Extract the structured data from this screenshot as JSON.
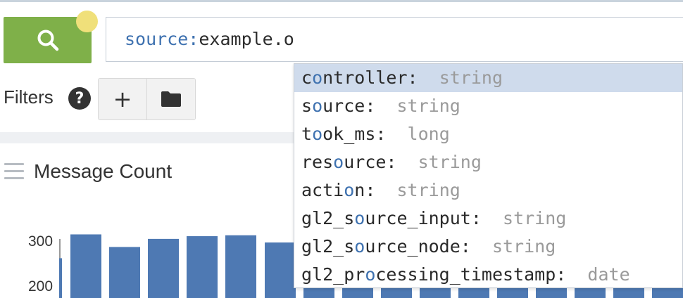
{
  "search": {
    "button_icon": "search-icon",
    "query_key": "source:",
    "query_value": "example.o"
  },
  "filters": {
    "label": "Filters",
    "help_glyph": "?",
    "add_glyph": "+",
    "add_icon": "plus-icon",
    "folder_icon": "folder-icon"
  },
  "panel": {
    "title": "Message Count",
    "menu_icon": "hamburger-icon"
  },
  "chart_data": {
    "type": "bar",
    "y_ticks": [
      "300",
      "200"
    ],
    "values": [
      265,
      318,
      290,
      308,
      314,
      316,
      300,
      296,
      292,
      294,
      290,
      295,
      292,
      296,
      290,
      292,
      294,
      295
    ],
    "bar_color": "#4e79b3"
  },
  "autocomplete": {
    "items": [
      {
        "pre": "c",
        "hl": "o",
        "post": "ntroller:",
        "type": "string"
      },
      {
        "pre": "s",
        "hl": "o",
        "post": "urce:",
        "type": "string"
      },
      {
        "pre": "t",
        "hl": "o",
        "post": "ok_ms:",
        "type": "long"
      },
      {
        "pre": "res",
        "hl": "o",
        "post": "urce:",
        "type": "string"
      },
      {
        "pre": "acti",
        "hl": "o",
        "post": "n:",
        "type": "string"
      },
      {
        "pre": "gl2_s",
        "hl": "o",
        "post": "urce_input:",
        "type": "string"
      },
      {
        "pre": "gl2_s",
        "hl": "o",
        "post": "urce_node:",
        "type": "string"
      },
      {
        "pre": "gl2_pr",
        "hl": "o",
        "post": "cessing_timestamp:",
        "type": "date"
      }
    ],
    "highlight_color": "#3f72b0",
    "selected_bg": "#cfdbec"
  },
  "colors": {
    "accent_green": "#7fb049",
    "notification_yellow": "#f0e07a"
  }
}
